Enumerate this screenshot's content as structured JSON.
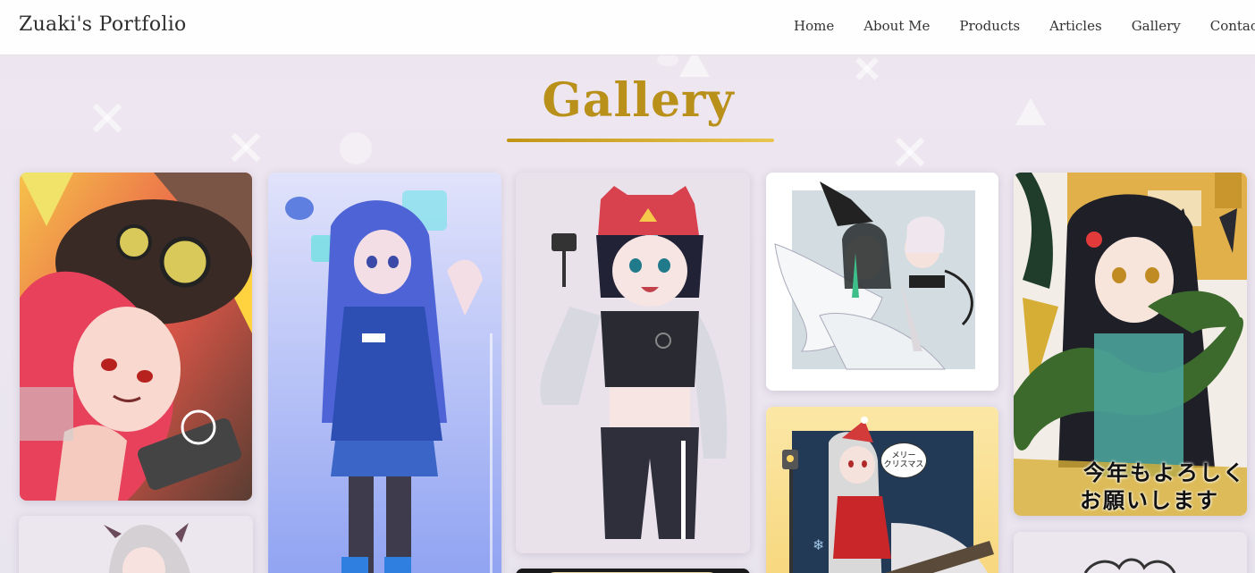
{
  "header": {
    "brand": "Zuaki's Portfolio",
    "nav": [
      "Home",
      "About Me",
      "Products",
      "Articles",
      "Gallery",
      "Contact"
    ]
  },
  "page": {
    "title": "Gallery"
  },
  "colors": {
    "accent_gold": "#b8901a",
    "nav_text": "#333333",
    "background": "#ece6f0"
  },
  "gallery": {
    "items": [
      {
        "name": "artwork-red-hair-goggles"
      },
      {
        "name": "artwork-blue-hair-jacket"
      },
      {
        "name": "artwork-cat-cap-camera"
      },
      {
        "name": "artwork-angel-devil-wings"
      },
      {
        "name": "artwork-snake-new-year"
      },
      {
        "name": "artwork-silver-hair-bottom"
      },
      {
        "name": "artwork-christmas"
      },
      {
        "name": "artwork-partial-bottom"
      }
    ],
    "newyear_text_line1": "今年もよろしく",
    "newyear_text_line2": "お願いします",
    "christmas_bubble": "メリー\nクリスマス"
  }
}
